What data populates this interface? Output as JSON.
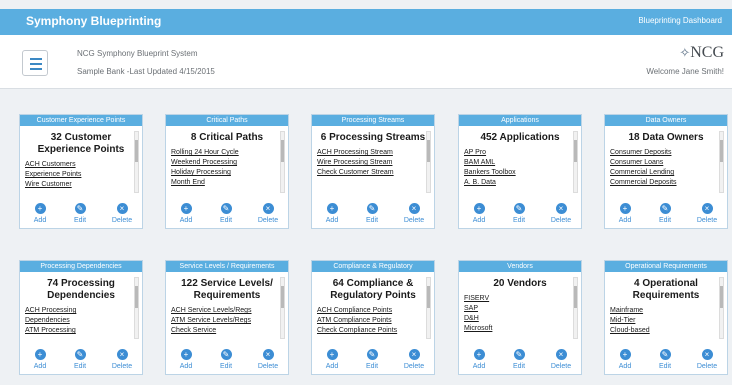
{
  "app": {
    "title": "Symphony Blueprinting",
    "dashboard_link": "Blueprinting Dashboard"
  },
  "header": {
    "system_name": "NCG Symphony Blueprint System",
    "subtitle": "Sample Bank -Last Updated 4/15/2015",
    "logo": "NCG",
    "welcome": "Welcome Jane Smith!"
  },
  "actions": {
    "add": "Add",
    "edit": "Edit",
    "delete": "Delete"
  },
  "cards": [
    {
      "header": "Customer Experience Points",
      "title": "32 Customer Experience Points",
      "links": [
        "ACH Customers",
        "Experience Points",
        "Wire Customer"
      ]
    },
    {
      "header": "Critical Paths",
      "title": "8 Critical Paths",
      "links": [
        "Rolling 24 Hour Cycle",
        "Weekend Processing",
        "Holiday Processing",
        "Month End"
      ]
    },
    {
      "header": "Processing Streams",
      "title": "6 Processing Streams",
      "links": [
        "ACH Processing Stream",
        "Wire Processing Stream",
        "Check Customer Stream"
      ]
    },
    {
      "header": "Applications",
      "title": "452 Applications",
      "links": [
        "AP Pro",
        "BAM AML",
        "Bankers Toolbox",
        "A. B. Data"
      ]
    },
    {
      "header": "Data Owners",
      "title": "18 Data Owners",
      "links": [
        "Consumer Deposits",
        "Consumer Loans",
        "Commercial Lending",
        "Commercial Deposits"
      ]
    },
    {
      "header": "Processing Dependencies",
      "title": "74 Processing Dependencies",
      "links": [
        "ACH Processing",
        "Dependencies",
        "ATM Processing"
      ]
    },
    {
      "header": "Service Levels / Requirements",
      "title": "122 Service Levels/ Requirements",
      "links": [
        "ACH Service Levels/Regs",
        "ATM Service Levels/Regs",
        "Check Service"
      ]
    },
    {
      "header": "Compliance & Regulatory",
      "title": "64 Compliance & Regulatory Points",
      "links": [
        "ACH Compliance Points",
        "ATM Compliance Points",
        "Check Compliance Points"
      ]
    },
    {
      "header": "Vendors",
      "title": "20 Vendors",
      "links": [
        "FISERV",
        "SAP",
        "D&H",
        "Microsoft"
      ]
    },
    {
      "header": "Operational Requirements",
      "title": "4 Operational Requirements",
      "links": [
        "Mainframe",
        "Mid-Tier",
        "Cloud-based"
      ]
    }
  ]
}
